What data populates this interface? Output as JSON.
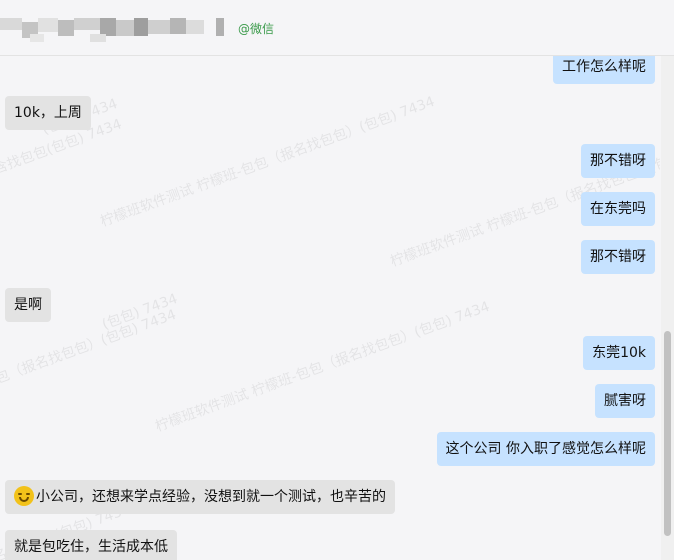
{
  "header": {
    "contact_tag": "@微信"
  },
  "watermarks": [
    "(包包) 7434",
    "含找包包(包包) 7434",
    "柠檬班软件测试 柠檬班-包包（报名找包包）(包包) 7434",
    "柠檬班软件测试 柠檬班-包包（报名找包包）(包包) 7434",
    "(包包) 7434",
    "包（报名找包包）(包包) 7434",
    "柠檬班软件测试 柠檬班-包包（报名找包包）(包包) 7434",
    "(报名找包包) (包包) 7434"
  ],
  "messages": [
    {
      "side": "out",
      "text": "工作怎么样呢"
    },
    {
      "side": "in",
      "text": "10k，上周"
    },
    {
      "side": "out",
      "text": "那不错呀"
    },
    {
      "side": "out",
      "text": "在东莞吗"
    },
    {
      "side": "out",
      "text": "那不错呀"
    },
    {
      "side": "in",
      "text": "是啊"
    },
    {
      "side": "out",
      "text": "东莞10k"
    },
    {
      "side": "out",
      "text": "腻害呀"
    },
    {
      "side": "out",
      "text": "这个公司 你入职了感觉怎么样呢"
    },
    {
      "side": "in",
      "emoji": "laughing-crying-emoji",
      "text": "小公司，还想来学点经验，没想到就一个测试，也辛苦的"
    },
    {
      "side": "in",
      "text": "就是包吃住，生活成本低"
    }
  ]
}
